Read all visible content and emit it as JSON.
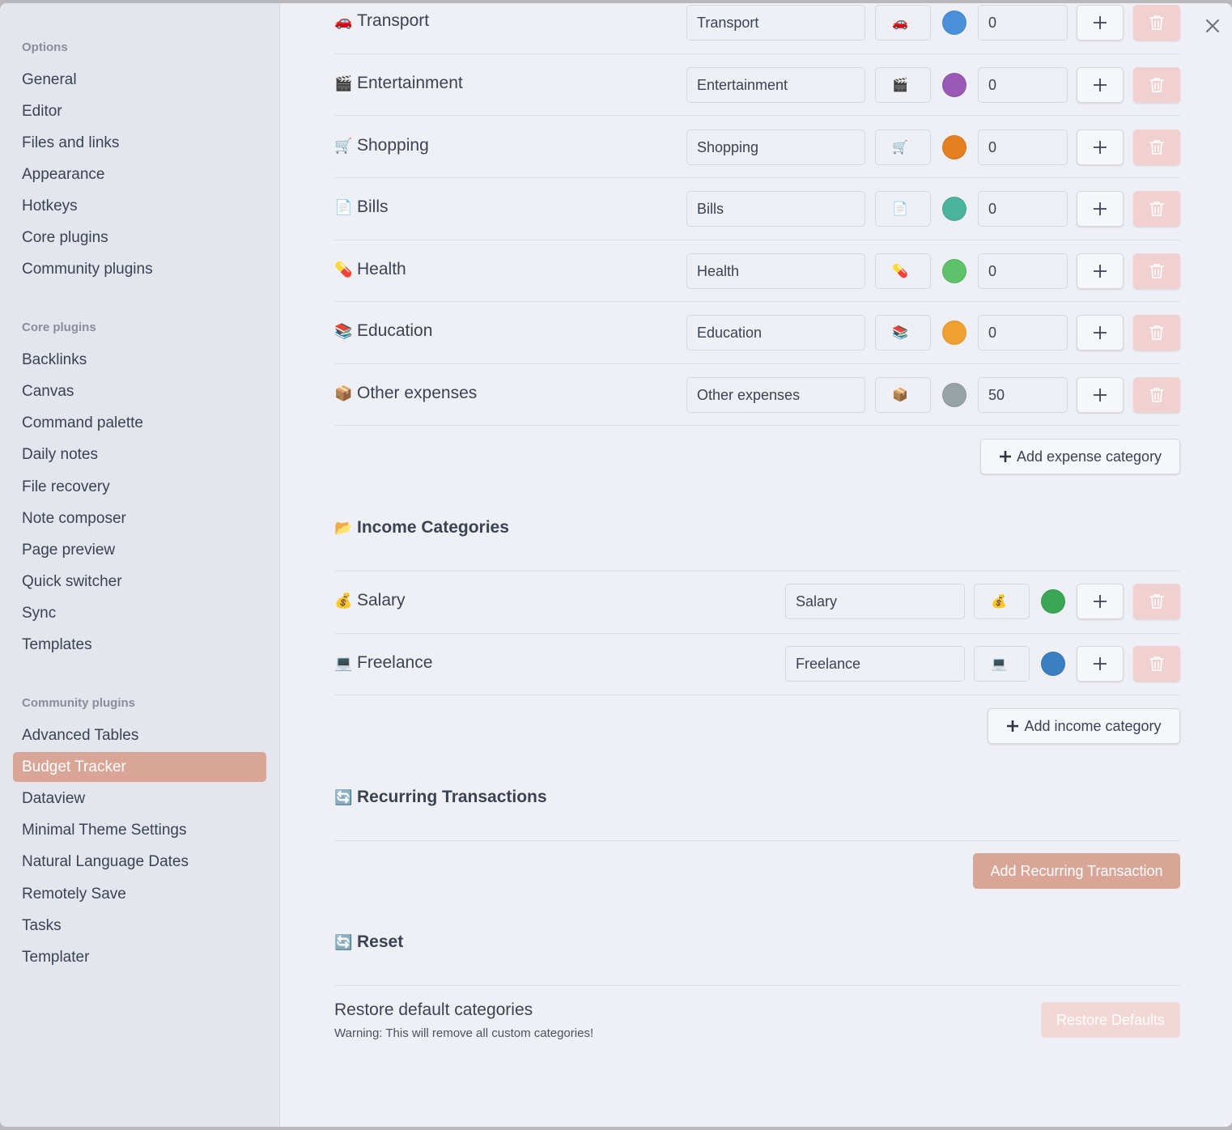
{
  "sidebar": {
    "sections": [
      {
        "title": "Options",
        "items": [
          "General",
          "Editor",
          "Files and links",
          "Appearance",
          "Hotkeys",
          "Core plugins",
          "Community plugins"
        ]
      },
      {
        "title": "Core plugins",
        "items": [
          "Backlinks",
          "Canvas",
          "Command palette",
          "Daily notes",
          "File recovery",
          "Note composer",
          "Page preview",
          "Quick switcher",
          "Sync",
          "Templates"
        ]
      },
      {
        "title": "Community plugins",
        "items": [
          "Advanced Tables",
          "Budget Tracker",
          "Dataview",
          "Minimal Theme Settings",
          "Natural Language Dates",
          "Remotely Save",
          "Tasks",
          "Templater"
        ]
      }
    ],
    "active_item": "Budget Tracker"
  },
  "expense_categories": [
    {
      "name": "Transport",
      "emoji": "🚗",
      "color": "#4a90d9",
      "amount": "0"
    },
    {
      "name": "Entertainment",
      "emoji": "🎬",
      "color": "#9b59b6",
      "amount": "0"
    },
    {
      "name": "Shopping",
      "emoji": "🛒",
      "color": "#e67e22",
      "amount": "0"
    },
    {
      "name": "Bills",
      "emoji": "📄",
      "color": "#4cb49c",
      "amount": "0"
    },
    {
      "name": "Health",
      "emoji": "💊",
      "color": "#5ec26a",
      "amount": "0"
    },
    {
      "name": "Education",
      "emoji": "📚",
      "color": "#f0a030",
      "amount": "0"
    },
    {
      "name": "Other expenses",
      "emoji": "📦",
      "color": "#98a3a6",
      "amount": "50"
    }
  ],
  "add_expense_label": "Add expense category",
  "income": {
    "heading": "Income Categories",
    "heading_emoji": "📂",
    "items": [
      {
        "name": "Salary",
        "emoji": "💰",
        "color": "#3aa655"
      },
      {
        "name": "Freelance",
        "emoji": "💻",
        "color": "#3a7fc1"
      }
    ],
    "add_label": "Add income category"
  },
  "recurring": {
    "heading": "Recurring Transactions",
    "heading_emoji": "🔄",
    "button": "Add Recurring Transaction"
  },
  "reset": {
    "heading": "Reset",
    "heading_emoji": "🔄",
    "title": "Restore default categories",
    "warning": "Warning: This will remove all custom categories!",
    "button": "Restore Defaults"
  },
  "colors": {
    "accent": "#d9a597",
    "accent_text": "#ffffff",
    "restore_bg": "#f3d6d6",
    "restore_text": "#ffffff",
    "delete_bg": "#f0d0d0"
  }
}
